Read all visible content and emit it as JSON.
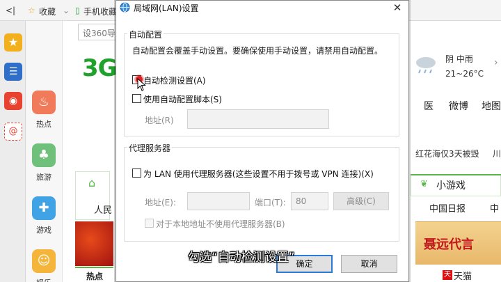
{
  "browser": {
    "back_label": "<|",
    "favorites_label": "收藏",
    "mobile_fav_label": "手机收藏",
    "address_value": "设360导",
    "brand_text": "3G",
    "categories": [
      {
        "label": "热点",
        "color": "#f07a5a"
      },
      {
        "label": "旅游",
        "color": "#6fc07a"
      },
      {
        "label": "游戏",
        "color": "#3fa3e6"
      },
      {
        "label": "娱乐",
        "color": "#f5b43a"
      }
    ],
    "weather": {
      "condition": "阴 中雨",
      "temp": "21~26°C"
    },
    "nav_links": [
      "医",
      "微博",
      "地图"
    ],
    "news_snippet": "红花海仅3天被毁",
    "news_suffix": "川",
    "games_label": "小游戏",
    "left_card_icon": "⌂",
    "left_card_text": "人民",
    "china_daily": "中国日报",
    "china_daily_suffix": "中",
    "banner_text": "聂远代言",
    "hot_tab_label": "热点",
    "tmall_label": "天猫",
    "tmall_icon_text": "天"
  },
  "dialog": {
    "title": "局域网(LAN)设置",
    "close_glyph": "✕",
    "auto_config": {
      "group_title": "自动配置",
      "note": "自动配置会覆盖手动设置。要确保使用手动设置，请禁用自动配置。",
      "auto_detect_label": "自动检测设置(A)",
      "auto_detect_checked": false,
      "use_script_label": "使用自动配置脚本(S)",
      "use_script_checked": false,
      "address_label": "地址(R)",
      "address_value": ""
    },
    "proxy": {
      "group_title": "代理服务器",
      "use_proxy_label": "为 LAN 使用代理服务器(这些设置不用于拨号或 VPN 连接)(X)",
      "use_proxy_checked": false,
      "address_label": "地址(E):",
      "address_value": "",
      "port_label": "端口(T):",
      "port_value": "80",
      "advanced_label": "高级(C)",
      "bypass_local_label": "对于本地地址不使用代理服务器(B)",
      "bypass_local_checked": false
    },
    "ok_label": "确定",
    "cancel_label": "取消"
  },
  "caption": "勾选“自动检测设置”",
  "colors": {
    "brand_green": "#1fa12b",
    "focus_blue": "#2b7bd6",
    "click_red": "#e02020"
  }
}
